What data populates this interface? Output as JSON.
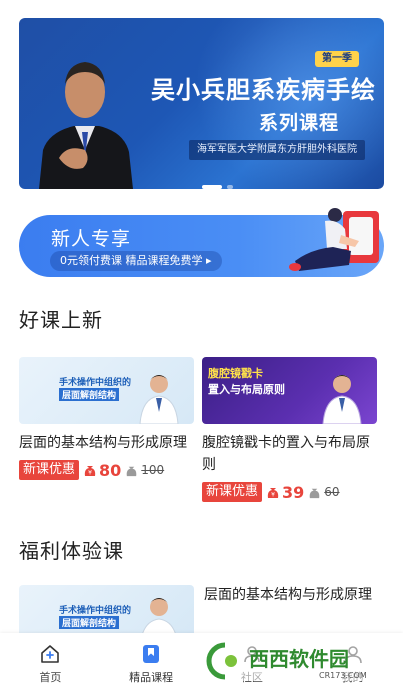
{
  "banner": {
    "season_badge": "第一季",
    "title_line1": "吴小兵胆系疾病手绘",
    "title_line2": "系列课程",
    "hospital": "海军军医大学附属东方肝胆外科医院",
    "carousel_count": 2,
    "carousel_active": 1
  },
  "newbie": {
    "title": "新人专享",
    "subtitle": "0元领付费课  精品课程免费学 ▸"
  },
  "sections": {
    "new_courses_title": "好课上新",
    "welfare_title": "福利体验课"
  },
  "courses": [
    {
      "thumb_line1": "手术操作中组织的",
      "thumb_line2": "层面解剖结构",
      "name": "层面的基本结构与形成原理",
      "tag": "新课优惠",
      "price": "80",
      "original_price": "100"
    },
    {
      "thumb_line1": "腹腔镜戳卡",
      "thumb_line2": "置入与布局原则",
      "name": "腹腔镜戳卡的置入与布局原则",
      "tag": "新课优惠",
      "price": "39",
      "original_price": "60"
    }
  ],
  "welfare": {
    "thumb_line1": "手术操作中组织的",
    "thumb_line2": "层面解剖结构",
    "name": "层面的基本结构与形成原理"
  },
  "nav": [
    {
      "label": "首页",
      "icon": "home-icon"
    },
    {
      "label": "精品课程",
      "icon": "course-bookmark-icon"
    },
    {
      "label": "社区",
      "icon": "community-icon"
    },
    {
      "label": "我的",
      "icon": "profile-icon"
    }
  ],
  "watermark": {
    "text": "西西软件园",
    "url": "CR173.COM"
  },
  "colors": {
    "brand_blue": "#3b7df0",
    "price_red": "#e8453c",
    "banner_blue": "#1f4fa6"
  }
}
